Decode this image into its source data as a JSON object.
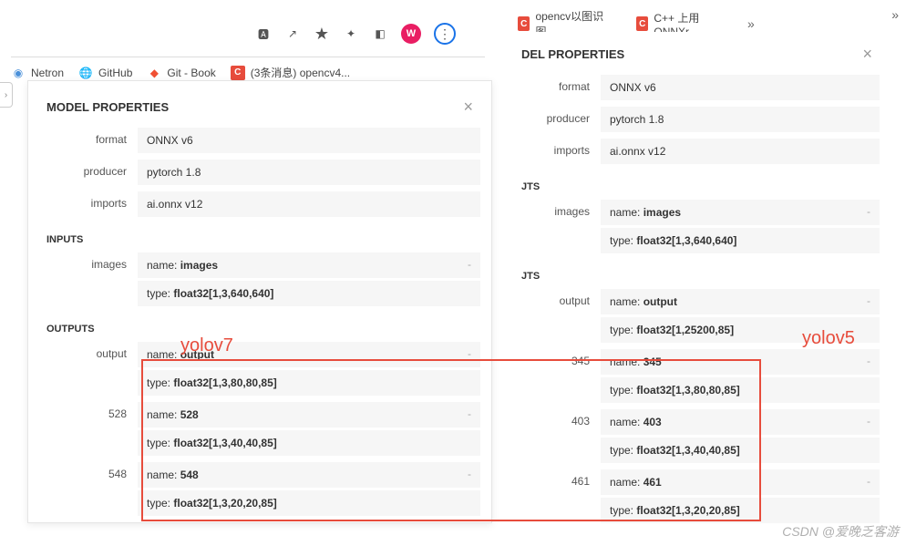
{
  "tabs": [
    {
      "icon": "C",
      "label": "opencv以图识图-..."
    },
    {
      "icon": "C",
      "label": "C++ 上用 ONNXr..."
    }
  ],
  "toolbar": {
    "avatar": "W"
  },
  "bookmarks": [
    {
      "icon_type": "dot",
      "label": "Netron"
    },
    {
      "icon_type": "gh",
      "label": "GitHub"
    },
    {
      "icon_type": "git",
      "label": "Git - Book"
    },
    {
      "icon_type": "c",
      "label": "(3条消息) opencv4..."
    }
  ],
  "left": {
    "title": "MODEL PROPERTIES",
    "props": [
      {
        "k": "format",
        "v": "ONNX v6"
      },
      {
        "k": "producer",
        "v": "pytorch 1.8"
      },
      {
        "k": "imports",
        "v": "ai.onnx v12"
      }
    ],
    "inputs_title": "INPUTS",
    "inputs": [
      {
        "k": "images",
        "name": "images",
        "type": "float32[1,3,640,640]"
      }
    ],
    "outputs_title": "OUTPUTS",
    "outputs": [
      {
        "k": "output",
        "name": "output",
        "type": "float32[1,3,80,80,85]"
      },
      {
        "k": "528",
        "name": "528",
        "type": "float32[1,3,40,40,85]"
      },
      {
        "k": "548",
        "name": "548",
        "type": "float32[1,3,20,20,85]"
      }
    ]
  },
  "right": {
    "title": "DEL PROPERTIES",
    "props": [
      {
        "k": "format",
        "v": "ONNX v6"
      },
      {
        "k": "producer",
        "v": "pytorch 1.8"
      },
      {
        "k": "imports",
        "v": "ai.onnx v12"
      }
    ],
    "inputs_title": "JTS",
    "inputs": [
      {
        "k": "images",
        "name": "images",
        "type": "float32[1,3,640,640]"
      }
    ],
    "outputs_title": "JTS",
    "outputs": [
      {
        "k": "output",
        "name": "output",
        "type": "float32[1,25200,85]"
      },
      {
        "k": "345",
        "name": "345",
        "type": "float32[1,3,80,80,85]"
      },
      {
        "k": "403",
        "name": "403",
        "type": "float32[1,3,40,40,85]"
      },
      {
        "k": "461",
        "name": "461",
        "type": "float32[1,3,20,20,85]"
      }
    ]
  },
  "annotations": {
    "left": "yolov7",
    "right": "yolov5"
  },
  "watermark": "CSDN @爱晚乏客游",
  "labels": {
    "name": "name: ",
    "type": "type: "
  }
}
